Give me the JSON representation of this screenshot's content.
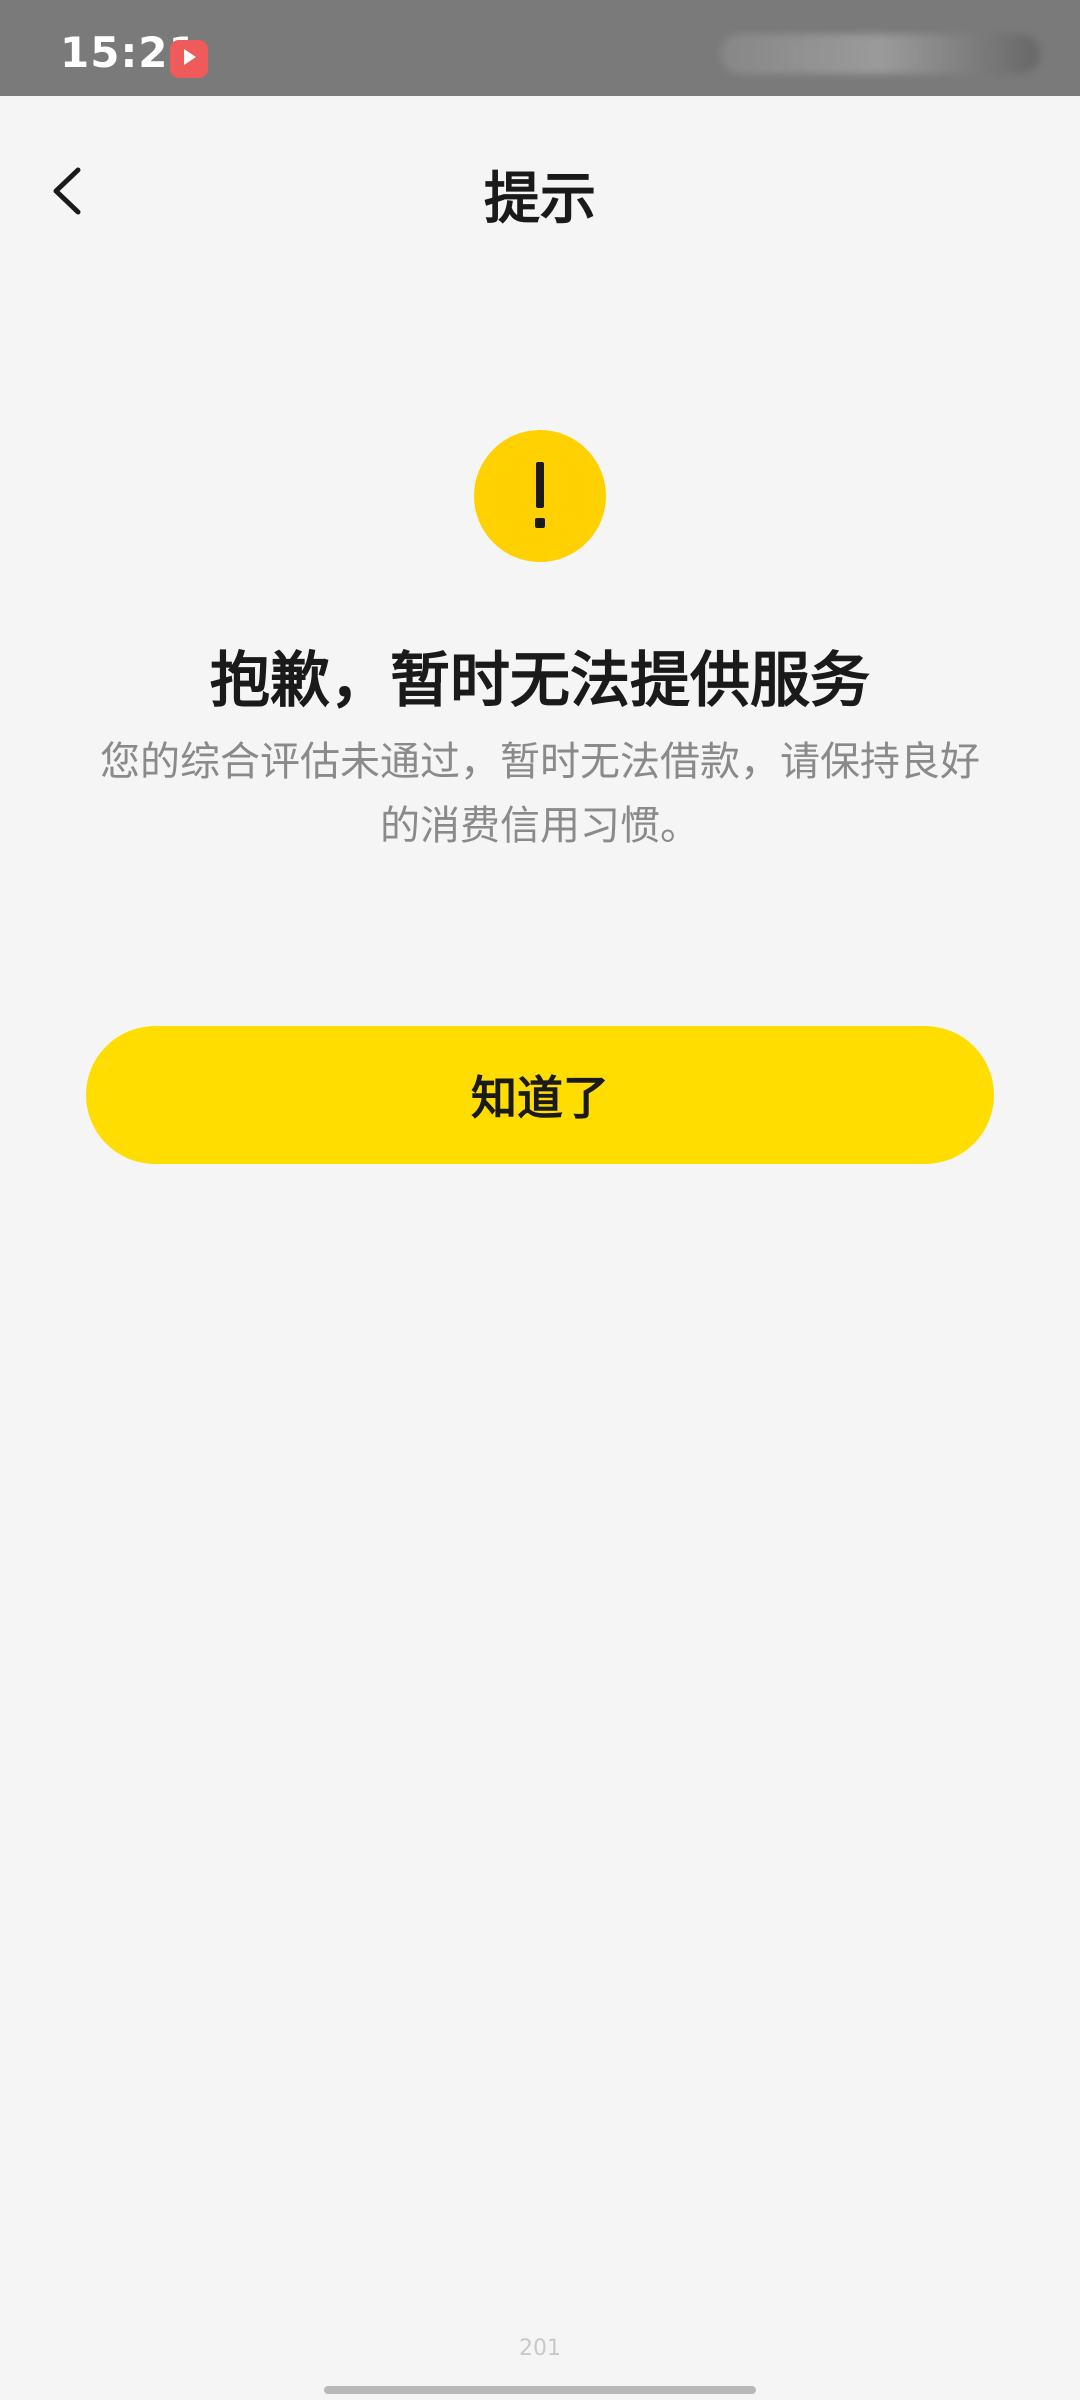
{
  "status_bar": {
    "time": "15:21"
  },
  "nav": {
    "title": "提示"
  },
  "result": {
    "title": "抱歉，暂时无法提供服务",
    "description": "您的综合评估未通过，暂时无法借款，请保持良好的消费信用习惯。"
  },
  "actions": {
    "confirm_label": "知道了"
  },
  "footer": {
    "page_number": "201"
  },
  "colors": {
    "accent": "#ffdd00",
    "icon_bg": "#ffd100",
    "background": "#f5f5f5",
    "secondary_text": "#8a8a8a"
  },
  "icons": {
    "back": "chevron-left-icon",
    "alert": "exclamation-icon"
  }
}
